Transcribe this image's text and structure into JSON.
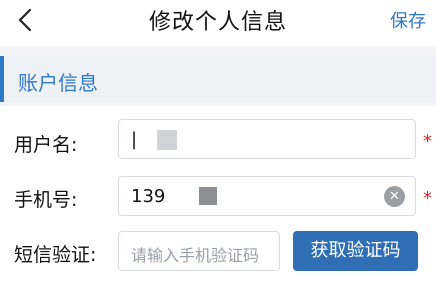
{
  "header": {
    "title": "修改个人信息",
    "save_label": "保存"
  },
  "section": {
    "title": "账户信息"
  },
  "form": {
    "username": {
      "label": "用户名:",
      "value": "|",
      "required_mark": "*"
    },
    "phone": {
      "label": "手机号:",
      "value": "139",
      "required_mark": "*"
    },
    "sms_code": {
      "label": "短信验证:",
      "placeholder": "请输入手机验证码",
      "button_label": "获取验证码"
    }
  },
  "colors": {
    "accent": "#2f79c9",
    "button": "#2f6eb4",
    "required": "#d62b2b"
  }
}
